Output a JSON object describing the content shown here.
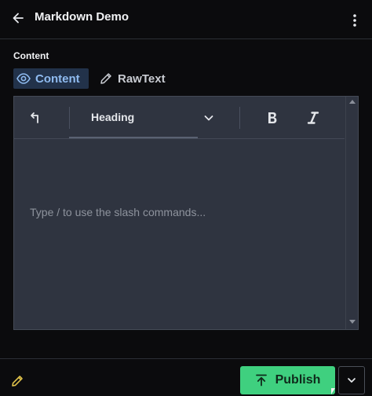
{
  "header": {
    "title": "Markdown Demo",
    "back_icon": "arrow-left-icon",
    "more_icon": "vertical-dots-icon"
  },
  "field": {
    "label": "Content"
  },
  "mode_tabs": [
    {
      "label": "Content",
      "icon": "eye-icon",
      "active": true
    },
    {
      "label": "RawText",
      "icon": "pencil-icon",
      "active": false
    }
  ],
  "toolbar": {
    "undo_icon": "corner-arrow-icon",
    "heading_select": {
      "value": "Heading",
      "icon": "chevron-down-icon"
    },
    "bold_icon": "bold-icon",
    "italic_icon": "italic-icon"
  },
  "editor": {
    "placeholder": "Type / to use the slash commands..."
  },
  "footer": {
    "edit_icon": "pencil-icon",
    "publish_label": "Publish",
    "publish_icon": "upload-icon",
    "menu_icon": "chevron-down-icon"
  },
  "colors": {
    "background": "#0b0b0d",
    "accent": "#3fd07f",
    "active_tab_bg": "#22324a",
    "active_tab_text": "#8fbbf0",
    "editor_bg": "#2f3440",
    "edit_icon": "#e0c24a"
  }
}
